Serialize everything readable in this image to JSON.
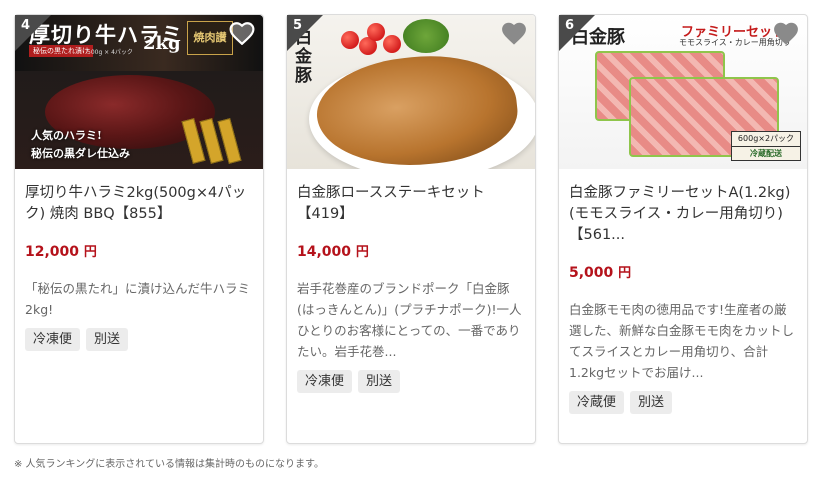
{
  "products": [
    {
      "rank": "4",
      "title": "厚切り牛ハラミ2kg(500g×4パック) 焼肉 BBQ【855】",
      "price": "12,000",
      "price_unit": "円",
      "description": "「秘伝の黒たれ」に漬け込んだ牛ハラミ2kg!",
      "tags": [
        "冷凍便",
        "別送"
      ],
      "thumb": {
        "title": "厚切り牛ハラミ",
        "sub": "秘伝の黒たれ漬け",
        "pack": "500g × 4パック",
        "kg": "2kg",
        "seal": "焼肉讃",
        "caption1": "人気のハラミ!",
        "caption2": "秘伝の黒ダレ仕込み"
      }
    },
    {
      "rank": "5",
      "title": "白金豚ロースステーキセット【419】",
      "price": "14,000",
      "price_unit": "円",
      "description": "岩手花巻産のブランドポーク「白金豚(はっきんとん)」(プラチナポーク)!一人ひとりのお客様にとっての、一番でありたい。岩手花巻...",
      "tags": [
        "冷凍便",
        "別送"
      ],
      "thumb": {
        "logo": "白金豚"
      }
    },
    {
      "rank": "6",
      "title": "白金豚ファミリーセットA(1.2kg)(モモスライス・カレー用角切り)【561...",
      "price": "5,000",
      "price_unit": "円",
      "description": "白金豚モモ肉の徳用品です!生産者の厳選した、新鮮な白金豚モモ肉をカットしてスライスとカレー用角切り、合計1.2kgセットでお届け...",
      "tags": [
        "冷蔵便",
        "別送"
      ],
      "thumb": {
        "logo": "白金豚",
        "head": "ファミリーセット",
        "sub": "モモスライス・カレー用角切り",
        "label1": "600g×2パック",
        "label2": "冷蔵配送"
      }
    }
  ],
  "footnote": "※ 人気ランキングに表示されている情報は集計時のものになります。",
  "colors": {
    "price": "#b5121b",
    "rank_badge": "#4a4a4a",
    "tag_bg": "#ececec"
  }
}
